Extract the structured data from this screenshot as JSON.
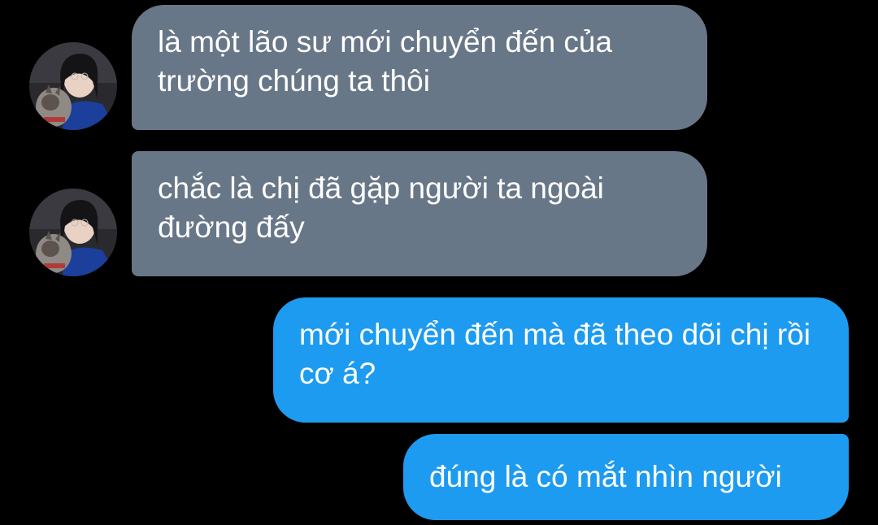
{
  "conversation": {
    "messages": [
      {
        "side": "received",
        "text": "là một lão sư mới chuyển đến của trường chúng ta thôi"
      },
      {
        "side": "received",
        "text": "chắc là chị đã gặp người ta ngoài đường đấy"
      },
      {
        "side": "sent",
        "text": "mới chuyển đến mà đã theo dõi chị rồi cơ á?"
      },
      {
        "side": "sent",
        "text": "đúng là có mắt nhìn người"
      }
    ]
  },
  "colors": {
    "background": "#000000",
    "received_bubble": "#687787",
    "sent_bubble": "#1d9bf0",
    "text": "#ffffff"
  },
  "icons": {
    "avatar": "profile-photo-avatar"
  }
}
